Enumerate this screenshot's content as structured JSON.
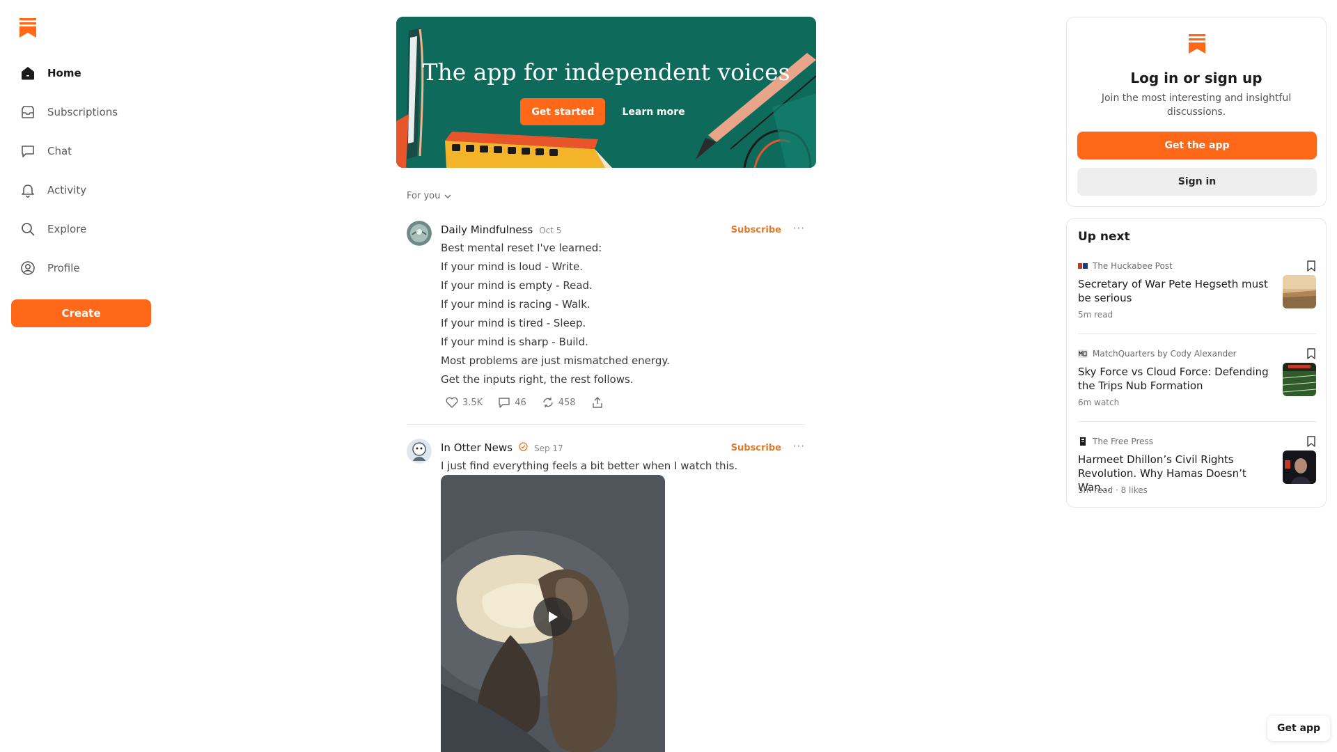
{
  "brand": {
    "accent": "#ff6719",
    "hero_bg": "#0e6b5c"
  },
  "sidebar": {
    "items": [
      {
        "label": "Home",
        "icon": "home-icon",
        "active": true
      },
      {
        "label": "Subscriptions",
        "icon": "inbox-icon"
      },
      {
        "label": "Chat",
        "icon": "chat-bubble-icon"
      },
      {
        "label": "Activity",
        "icon": "bell-icon"
      },
      {
        "label": "Explore",
        "icon": "search-icon"
      },
      {
        "label": "Profile",
        "icon": "user-circle-icon"
      }
    ],
    "create_label": "Create"
  },
  "hero": {
    "title": "The app for independent voices",
    "primary_label": "Get started",
    "secondary_label": "Learn more"
  },
  "feed": {
    "filter_label": "For you",
    "posts": [
      {
        "publication": "Daily Mindfulness",
        "date": "Oct 5",
        "subscribe_label": "Subscribe",
        "more": "···",
        "lines": [
          "Best mental reset I've learned:",
          "If your mind is loud - Write.",
          "If your mind is empty - Read.",
          "If your mind is racing - Walk.",
          "If your mind is tired - Sleep.",
          "If your mind is sharp - Build.",
          "Most problems are just mismatched energy.",
          "Get the inputs right, the rest follows."
        ],
        "likes": "3.5K",
        "comments": "46",
        "restacks": "458"
      },
      {
        "publication": "In Otter News",
        "date": "Sep 17",
        "subscribe_label": "Subscribe",
        "more": "···",
        "text": "I just find everything feels a bit better when I watch this."
      }
    ]
  },
  "login": {
    "title": "Log in or sign up",
    "description": "Join the most interesting and insightful discussions.",
    "get_app_label": "Get the app",
    "signin_label": "Sign in"
  },
  "upnext": {
    "title": "Up next",
    "items": [
      {
        "source": "The Huckabee Post",
        "title": "Secretary of War Pete Hegseth must be serious",
        "meta": "5m read"
      },
      {
        "source": "MatchQuarters by Cody Alexander",
        "title": "Sky Force vs Cloud Force: Defending the Trips Nub Formation",
        "meta": "6m watch"
      },
      {
        "source": "The Free Press",
        "title": "Harmeet Dhillon’s Civil Rights Revolution. Why Hamas Doesn’t Wan...",
        "meta": "5m read · 8 likes"
      }
    ]
  },
  "float": {
    "get_app_label": "Get app"
  }
}
